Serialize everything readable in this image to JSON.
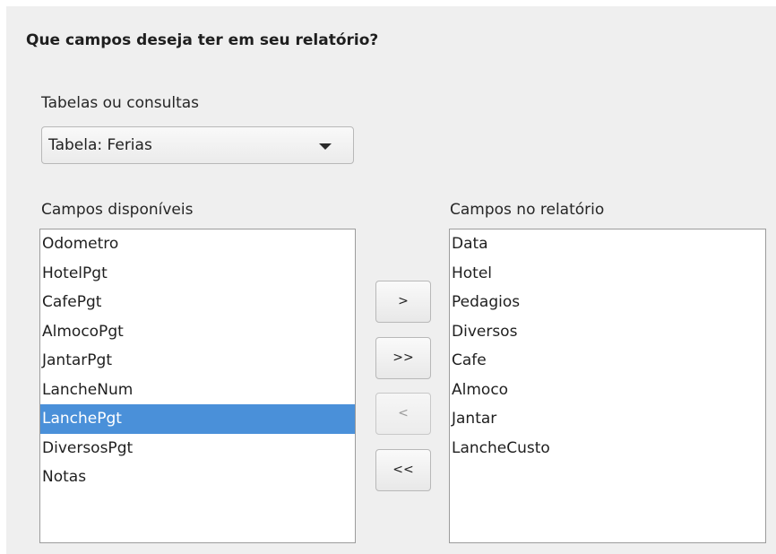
{
  "heading": "Que campos deseja ter em seu relatório?",
  "tables_label": "Tabelas ou consultas",
  "table_select": {
    "value": "Tabela: Ferias"
  },
  "available": {
    "label": "Campos disponíveis",
    "items": [
      "Odometro",
      "HotelPgt",
      "CafePgt",
      "AlmocoPgt",
      "JantarPgt",
      "LancheNum",
      "LanchePgt",
      "DiversosPgt",
      "Notas"
    ],
    "selected": "LanchePgt"
  },
  "report": {
    "label": "Campos no relatório",
    "items": [
      "Data",
      "Hotel",
      "Pedagios",
      "Diversos",
      "Cafe",
      "Almoco",
      "Jantar",
      "LancheCusto"
    ]
  },
  "buttons": {
    "add": ">",
    "add_all": ">>",
    "remove": "<",
    "remove_all": "<<"
  },
  "colors": {
    "selection": "#4a90d9",
    "panel": "#efefef"
  }
}
